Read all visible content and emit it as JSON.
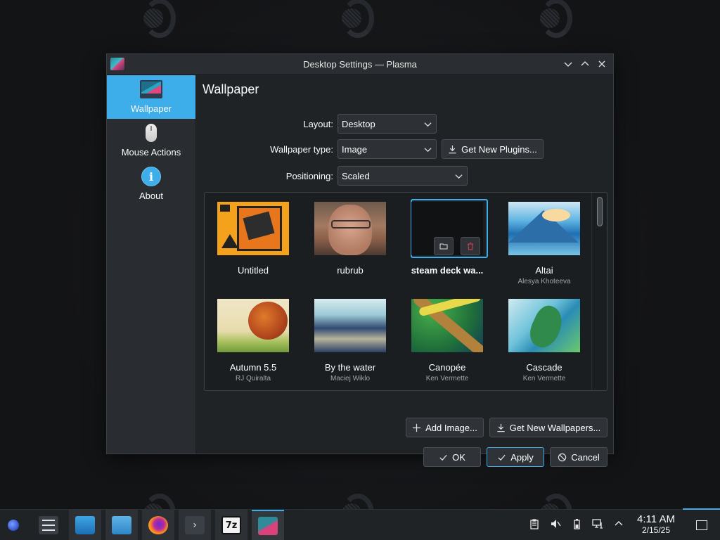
{
  "window": {
    "title": "Desktop Settings — Plasma"
  },
  "sidebar": {
    "items": [
      {
        "label": "Wallpaper",
        "icon": "monitor-icon",
        "active": true
      },
      {
        "label": "Mouse Actions",
        "icon": "mouse-icon",
        "active": false
      },
      {
        "label": "About",
        "icon": "info-icon",
        "active": false
      }
    ]
  },
  "page": {
    "title": "Wallpaper",
    "layout_label": "Layout:",
    "layout_value": "Desktop",
    "wallpaper_type_label": "Wallpaper type:",
    "wallpaper_type_value": "Image",
    "get_plugins_label": "Get New Plugins...",
    "positioning_label": "Positioning:",
    "positioning_value": "Scaled"
  },
  "wallpapers": [
    {
      "name": "Untitled",
      "author": "",
      "selected": false
    },
    {
      "name": "rubrub",
      "author": "",
      "selected": false
    },
    {
      "name": "steam deck wa...",
      "author": "",
      "selected": true
    },
    {
      "name": "Altai",
      "author": "Alesya Khoteeva",
      "selected": false
    },
    {
      "name": "Autumn 5.5",
      "author": "RJ Quiralta",
      "selected": false
    },
    {
      "name": "By the water",
      "author": "Maciej Wiklo",
      "selected": false
    },
    {
      "name": "Canopée",
      "author": "Ken Vermette",
      "selected": false
    },
    {
      "name": "Cascade",
      "author": "Ken Vermette",
      "selected": false
    }
  ],
  "actions": {
    "add_image": "Add Image...",
    "get_wallpapers": "Get New Wallpapers...",
    "ok": "OK",
    "apply": "Apply",
    "cancel": "Cancel"
  },
  "taskbar": {
    "time": "4:11 AM",
    "date": "2/15/25",
    "apps": [
      "launcher-icon",
      "system-settings-icon",
      "discover-store-icon",
      "dolphin-files-icon",
      "firefox-icon",
      "terminal-icon",
      "7zip-icon",
      "plasma-settings-icon"
    ],
    "seven_zip_label": "7z",
    "accent": "#3daee9"
  }
}
